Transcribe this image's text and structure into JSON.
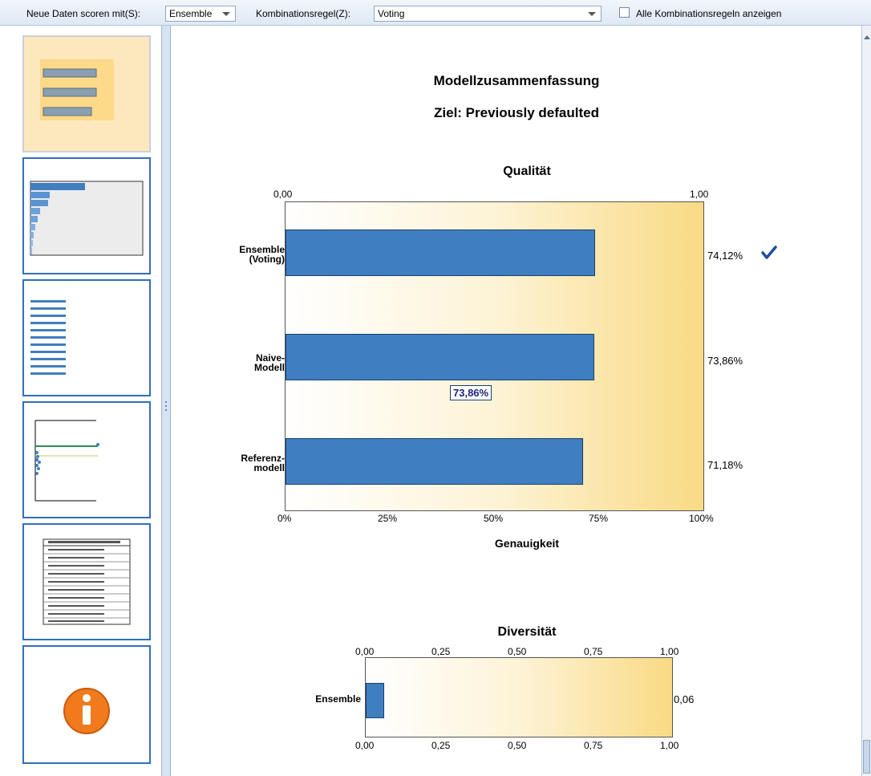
{
  "toolbar": {
    "score_label": "Neue Daten scoren mit(S):",
    "score_value": "Ensemble",
    "rule_label": "Kombinationsregel(Z):",
    "rule_value": "Voting",
    "show_all_label": "Alle Kombinationsregeln anzeigen",
    "show_all_checked": false
  },
  "sidebar": {
    "thumbnails": [
      {
        "view": "model-summary",
        "selected": true
      },
      {
        "view": "predictor-importance",
        "selected": false
      },
      {
        "view": "predictor-frequency",
        "selected": false
      },
      {
        "view": "component-model-accuracy",
        "selected": false
      },
      {
        "view": "component-model-details",
        "selected": false
      },
      {
        "view": "information",
        "selected": false
      }
    ]
  },
  "summary": {
    "title": "Modellzusammenfassung",
    "target": "Ziel: Previously defaulted"
  },
  "chart_data": [
    {
      "type": "bar",
      "orientation": "horizontal",
      "title": "Qualität",
      "xlabel": "Genauigkeit",
      "ylabel": "",
      "xlim": [
        0,
        100
      ],
      "top_axis_ticks": [
        "0,00",
        "1,00"
      ],
      "bottom_axis_ticks": [
        "0%",
        "25%",
        "50%",
        "75%",
        "100%"
      ],
      "categories": [
        [
          "Ensemble",
          "(Voting)"
        ],
        [
          "Naive-",
          "Modell"
        ],
        [
          "Referenz-",
          "modell"
        ]
      ],
      "values": [
        74.12,
        73.86,
        71.18
      ],
      "value_labels": [
        "74,12%",
        "73,86%",
        "71,18%"
      ],
      "best_marker_index": 0,
      "tooltip": "73,86%",
      "grid": false
    },
    {
      "type": "bar",
      "orientation": "horizontal",
      "title": "Diversität",
      "xlabel": "",
      "ylabel": "",
      "xlim": [
        0,
        1
      ],
      "ticks": [
        "0,00",
        "0,25",
        "0,50",
        "0,75",
        "1,00"
      ],
      "categories": [
        "Ensemble"
      ],
      "values": [
        0.06
      ],
      "value_labels": [
        "0,06"
      ],
      "grid": false
    }
  ],
  "colors": {
    "bar": "#3f7fc1",
    "bar_border": "#1b3f6a",
    "plot_gradient_end": "#f9da84",
    "thumb_selected": "#fde8bd",
    "thumb_border": "#2f6fbf",
    "info": "#f07a1c",
    "check": "#1f4e9c"
  }
}
